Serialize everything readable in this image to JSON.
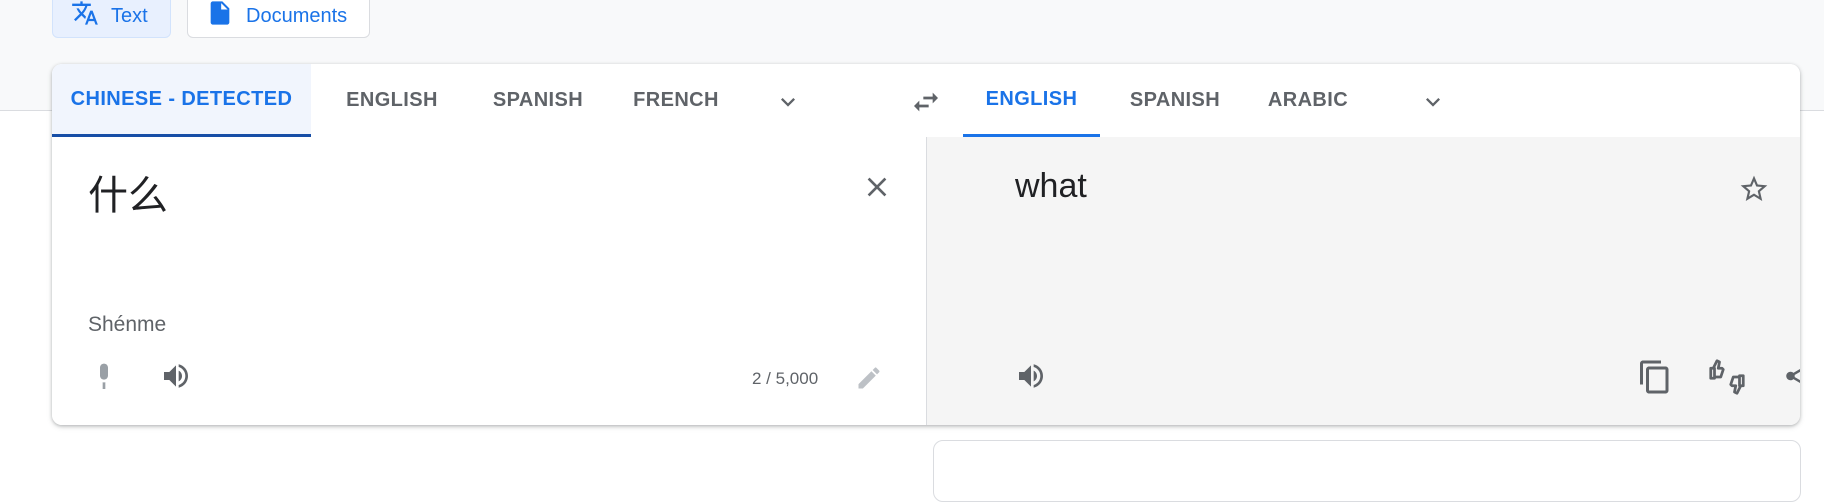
{
  "modes": {
    "text_label": "Text",
    "documents_label": "Documents"
  },
  "source": {
    "languages": [
      "CHINESE - DETECTED",
      "ENGLISH",
      "SPANISH",
      "FRENCH"
    ],
    "text": "什么",
    "transliteration": "Shénme",
    "char_count": "2 / 5,000"
  },
  "target": {
    "languages": [
      "ENGLISH",
      "SPANISH",
      "ARABIC"
    ],
    "text": "what"
  },
  "colors": {
    "accent": "#1a73e8",
    "target_bg": "#f5f5f5",
    "icon": "#5f6368"
  }
}
